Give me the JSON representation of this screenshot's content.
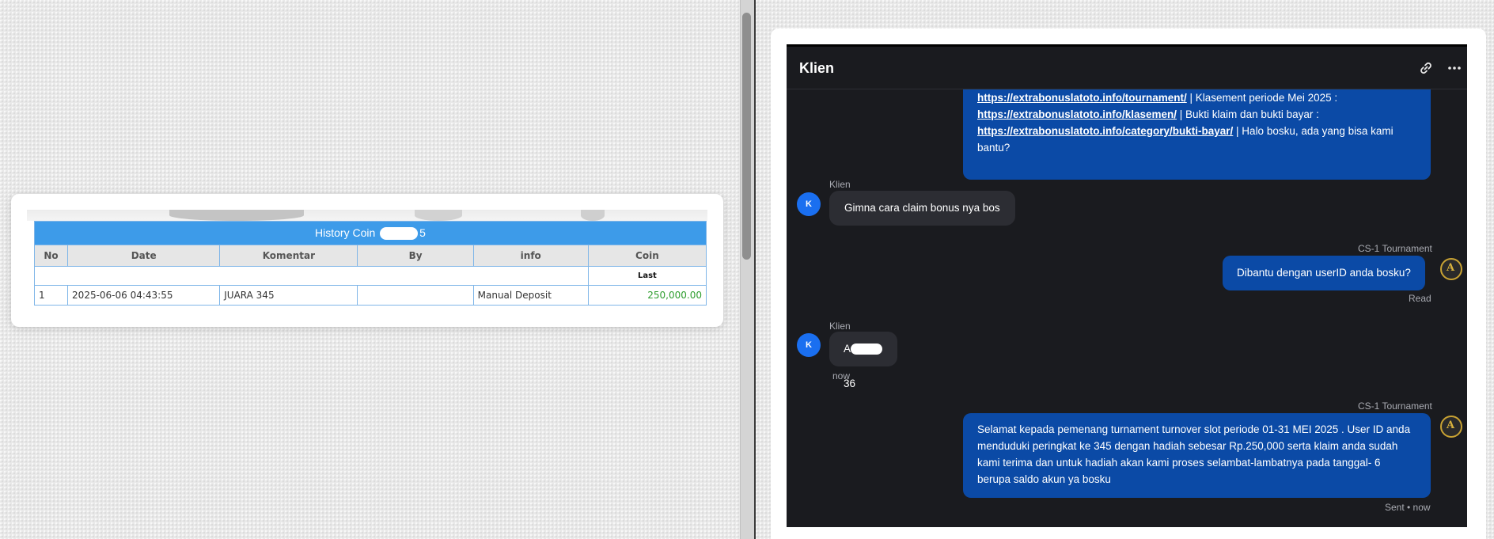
{
  "history": {
    "title_prefix": "History Coin",
    "title_suffix": "5",
    "columns": [
      "No",
      "Date",
      "Komentar",
      "By",
      "info",
      "Coin"
    ],
    "sub_header": "Last",
    "rows": [
      {
        "no": "1",
        "date": "2025-06-06 04:43:55",
        "komentar": "JUARA 345",
        "by": "",
        "info": "Manual Deposit",
        "coin": "250,000.00"
      }
    ]
  },
  "chat": {
    "title": "Klien",
    "icons": {
      "link": "link-icon",
      "more": "more-icon"
    },
    "messages": {
      "m1": {
        "url1": "https://extrabonuslatoto.info/tournament/",
        "text1": " | Klasement periode Mei 2025 :",
        "url2": "https://extrabonuslatoto.info/klasemen/",
        "text2": " | Bukti klaim dan bukti bayar :",
        "url3": "https://extrabonuslatoto.info/category/bukti-bayar/",
        "text3": " | Halo bosku, ada yang bisa kami bantu?"
      },
      "m2": {
        "sender": "Klien",
        "avatar": "K",
        "text": "Gimna cara claim bonus nya bos"
      },
      "m3": {
        "sender": "CS-1 Tournament",
        "text": "Dibantu dengan userID anda bosku?",
        "status": "Read"
      },
      "m4": {
        "sender": "Klien",
        "avatar": "K",
        "text": "A",
        "text_tail": "36",
        "time": "now"
      },
      "m5": {
        "sender": "CS-1 Tournament",
        "text": "Selamat kepada pemenang turnament turnover slot periode 01-31 MEI 2025 . User ID anda menduduki peringkat ke 345 dengan hadiah sebesar Rp.250,000 serta klaim anda sudah kami terima dan untuk hadiah akan kami proses selambat-lambatnya pada tanggal- 6 berupa saldo akun ya bosku",
        "status": "Sent • now"
      }
    },
    "agent_avatar_letter": "A"
  }
}
